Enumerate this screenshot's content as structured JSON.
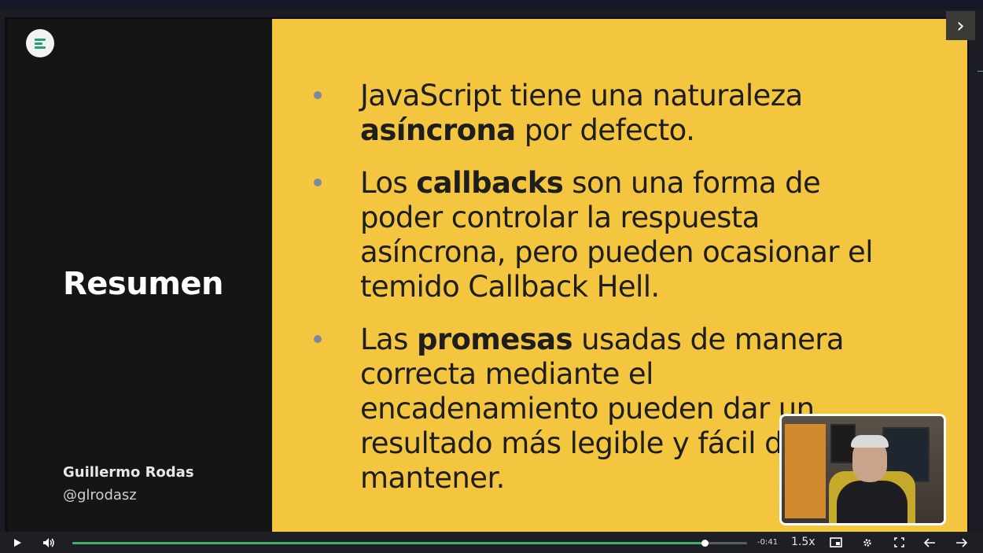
{
  "slide": {
    "title": "Resumen",
    "author_name": "Guillermo Rodas",
    "author_handle": "@glrodasz",
    "bullets": [
      {
        "segments": [
          {
            "text": "JavaScript tiene una naturaleza ",
            "bold": false
          },
          {
            "text": "asíncrona",
            "bold": true
          },
          {
            "text": " por defecto.",
            "bold": false
          }
        ]
      },
      {
        "segments": [
          {
            "text": "Los ",
            "bold": false
          },
          {
            "text": "callbacks",
            "bold": true
          },
          {
            "text": " son una forma de poder controlar la respuesta asíncrona, pero pueden ocasionar el temido Callback Hell.",
            "bold": false
          }
        ]
      },
      {
        "segments": [
          {
            "text": "Las ",
            "bold": false
          },
          {
            "text": "promesas",
            "bold": true
          },
          {
            "text": " usadas de manera correcta mediante el encadenamiento pueden dar un resultado más legible y fácil de mantener.",
            "bold": false
          }
        ]
      }
    ]
  },
  "player": {
    "time_remaining": "-0:41",
    "playback_speed": "1.5x",
    "progress_fraction": 0.937,
    "next_slide_glyph": "›"
  },
  "icons": {
    "logo": "platzi-logo-icon",
    "play": "play-icon",
    "volume": "volume-icon",
    "pip": "picture-in-picture-icon",
    "settings": "gear-icon",
    "fullscreen": "fullscreen-icon",
    "prev": "arrow-left-icon",
    "next": "arrow-right-icon"
  },
  "colors": {
    "slide_background": "#f4c640",
    "left_panel": "#151515",
    "progress_fill": "#41b06e"
  }
}
